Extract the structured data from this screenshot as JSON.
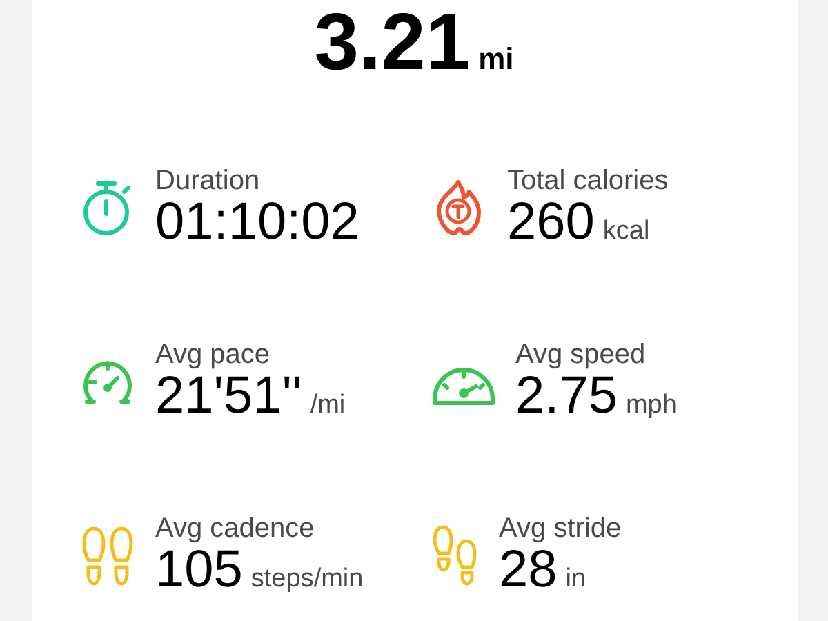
{
  "distance": {
    "value": "3.21",
    "unit": "mi"
  },
  "metrics": [
    {
      "kind": "stopwatch",
      "color": "#1ec99a",
      "label": "Duration",
      "value": "01:10:02"
    },
    {
      "kind": "flame",
      "color": "#ec5433",
      "label": "Total calories",
      "value": "260",
      "unit": "kcal"
    },
    {
      "kind": "pace",
      "color": "#3cc453",
      "label": "Avg pace",
      "value": "21'51''",
      "unit": "/mi"
    },
    {
      "kind": "speedometer",
      "color": "#3cc453",
      "label": "Avg speed",
      "value": "2.75",
      "unit": "mph"
    },
    {
      "kind": "footprints",
      "color": "#f5be1d",
      "label": "Avg cadence",
      "value": "105",
      "unit": "steps/min"
    },
    {
      "kind": "footprints-offset",
      "color": "#f5be1d",
      "label": "Avg stride",
      "value": "28",
      "unit": "in"
    }
  ]
}
